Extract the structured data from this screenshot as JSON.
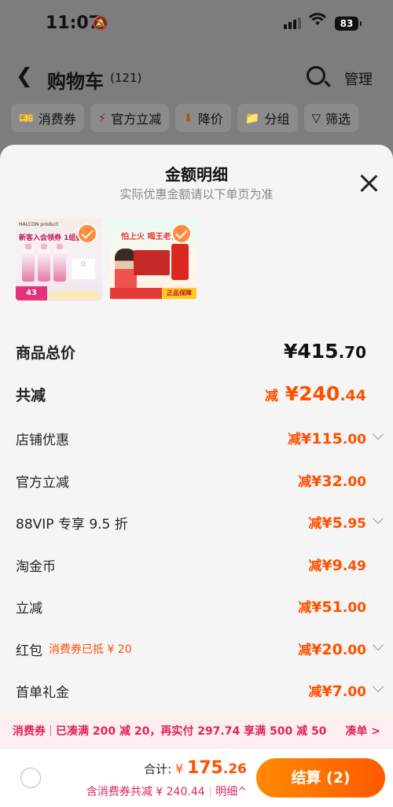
{
  "status_bar": {
    "time": "11:07",
    "battery": "83"
  },
  "header": {
    "title": "购物车",
    "count": "(121)",
    "manage": "管理"
  },
  "filters": [
    {
      "label": "消费券",
      "icon": "coupon-icon"
    },
    {
      "label": "官方立减",
      "icon": "lightning-icon"
    },
    {
      "label": "降价",
      "icon": "price-drop-icon"
    },
    {
      "label": "分组",
      "icon": "folder-icon"
    },
    {
      "label": "筛选",
      "icon": "funnel-icon"
    }
  ],
  "sheet": {
    "title": "金额明细",
    "subtitle": "实际优惠金额请以下单页为准",
    "products": [
      {
        "name": "HALCON product",
        "banner": "新客入会领券  1组叠",
        "price_tag": "43"
      },
      {
        "name": "王老吉 product",
        "banner": "怕上火  喝王老吉",
        "tag": "正品保障"
      }
    ],
    "rows": [
      {
        "label": "商品总价",
        "value_int": "¥415",
        "value_dec": ".70"
      },
      {
        "label": "共减",
        "prefix": "减",
        "value_int": "¥240",
        "value_dec": ".44"
      },
      {
        "label": "店铺优惠",
        "prefix": "减",
        "value_int": "¥115",
        "value_dec": ".00",
        "expand": true
      },
      {
        "label": "官方立减",
        "prefix": "减",
        "value_int": "¥32",
        "value_dec": ".00"
      },
      {
        "label": "88VIP 专享 9.5 折",
        "prefix": "减",
        "value_int": "¥5",
        "value_dec": ".95",
        "expand": true
      },
      {
        "label": "淘金币",
        "prefix": "减",
        "value_int": "¥9",
        "value_dec": ".49"
      },
      {
        "label": "立减",
        "prefix": "减",
        "value_int": "¥51",
        "value_dec": ".00"
      },
      {
        "label": "红包",
        "note": "消费券已抵 ¥ 20",
        "prefix": "减",
        "value_int": "¥20",
        "value_dec": ".00",
        "expand": true
      },
      {
        "label": "首单礼金",
        "prefix": "减",
        "value_int": "¥7",
        "value_dec": ".00",
        "expand": true
      }
    ]
  },
  "banner": {
    "tag": "消费券",
    "text": "已凑满 200 减 20，再实付 297.74 享满 500 减 50",
    "action": "凑单 >"
  },
  "bottom": {
    "total_label": "合计: ",
    "currency": "¥",
    "total_int": "175",
    "total_dec": ".26",
    "sub_text": "含消费券共减 ¥ 240.44",
    "detail": "明细^",
    "checkout": "结算 (2)"
  },
  "colors": {
    "accent": "#ff5000",
    "pink": "#e0245e",
    "check": "#ff8b3d"
  }
}
